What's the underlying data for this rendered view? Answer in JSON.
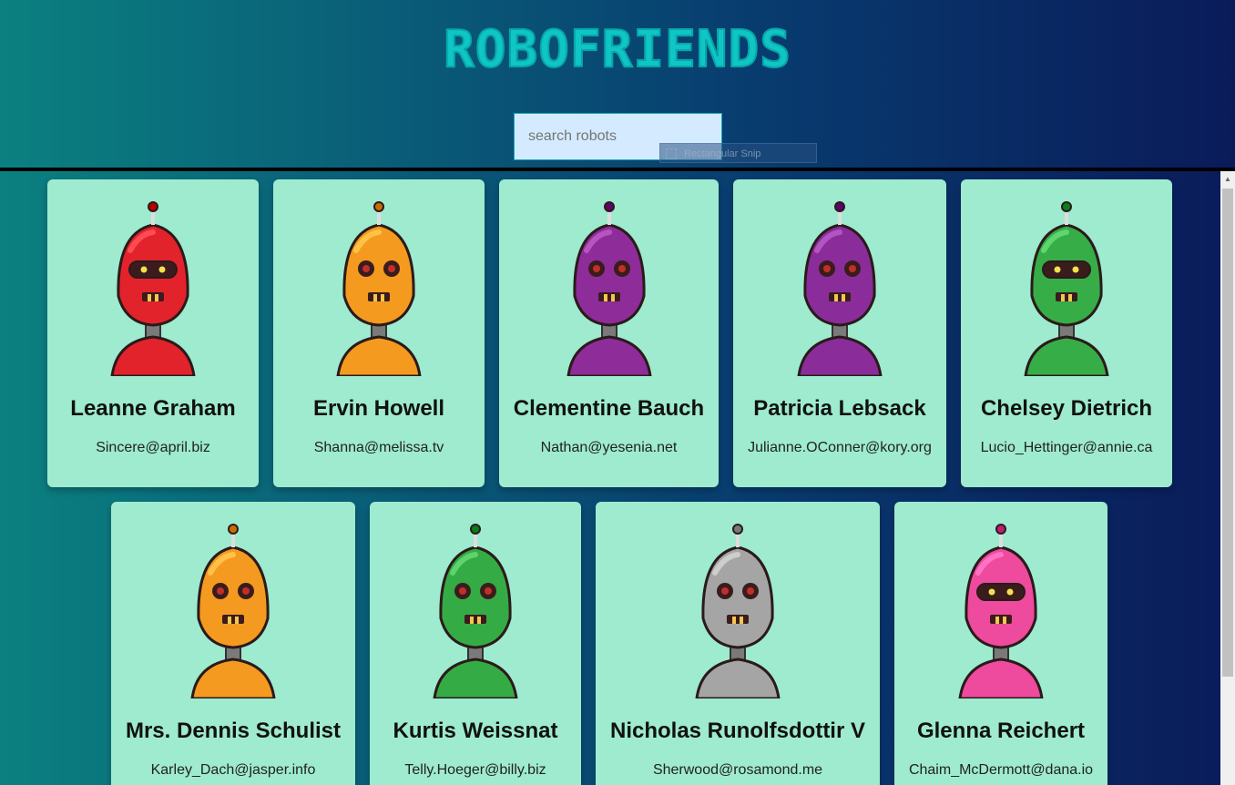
{
  "header": {
    "logo": "ROBOFRIENDS"
  },
  "search": {
    "placeholder": "search robots",
    "value": ""
  },
  "snip_tooltip": {
    "label": "Rectangular Snip"
  },
  "robots": [
    {
      "name": "Leanne Graham",
      "email": "Sincere@april.biz",
      "body_color": "#e3232b",
      "visor": true
    },
    {
      "name": "Ervin Howell",
      "email": "Shanna@melissa.tv",
      "body_color": "#f49a1f",
      "visor": false
    },
    {
      "name": "Clementine Bauch",
      "email": "Nathan@yesenia.net",
      "body_color": "#8e2c9a",
      "visor": false
    },
    {
      "name": "Patricia Lebsack",
      "email": "Julianne.OConner@kory.org",
      "body_color": "#8a2d9b",
      "visor": false
    },
    {
      "name": "Chelsey Dietrich",
      "email": "Lucio_Hettinger@annie.ca",
      "body_color": "#36ad47",
      "visor": true
    },
    {
      "name": "Mrs. Dennis Schulist",
      "email": "Karley_Dach@jasper.info",
      "body_color": "#f59a20",
      "visor": false
    },
    {
      "name": "Kurtis Weissnat",
      "email": "Telly.Hoeger@billy.biz",
      "body_color": "#35ab45",
      "visor": false
    },
    {
      "name": "Nicholas Runolfsdottir V",
      "email": "Sherwood@rosamond.me",
      "body_color": "#a5a5a5",
      "visor": false
    },
    {
      "name": "Glenna Reichert",
      "email": "Chaim_McDermott@dana.io",
      "body_color": "#ee4a9e",
      "visor": true
    }
  ]
}
